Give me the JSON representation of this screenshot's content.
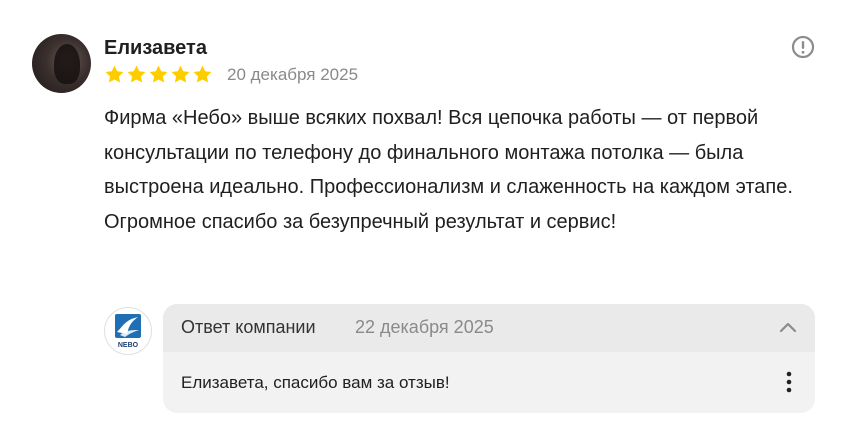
{
  "review": {
    "author": "Елизавета",
    "rating": 5,
    "rating_max": 5,
    "date": "20 декабря 2025",
    "text": "Фирма «Небо» выше всяких похвал! Вся цепочка работы — от первой консультации по телефону до финального монтажа потолка — была выстроена идеально. Профессионализм и слаженность на каждом этапе. Огромное спасибо за безупречный результат и сервис!",
    "star_color": "#ffcc00",
    "report_icon": "exclamation-circle-icon"
  },
  "company_reply": {
    "title": "Ответ компании",
    "date": "22 декабря 2025",
    "text": "Елизавета, спасибо вам за отзыв!",
    "logo_label": "NEBO",
    "logo_color": "#1f6fb5",
    "collapse_icon": "chevron-up-icon",
    "more_icon": "more-vertical-icon"
  }
}
